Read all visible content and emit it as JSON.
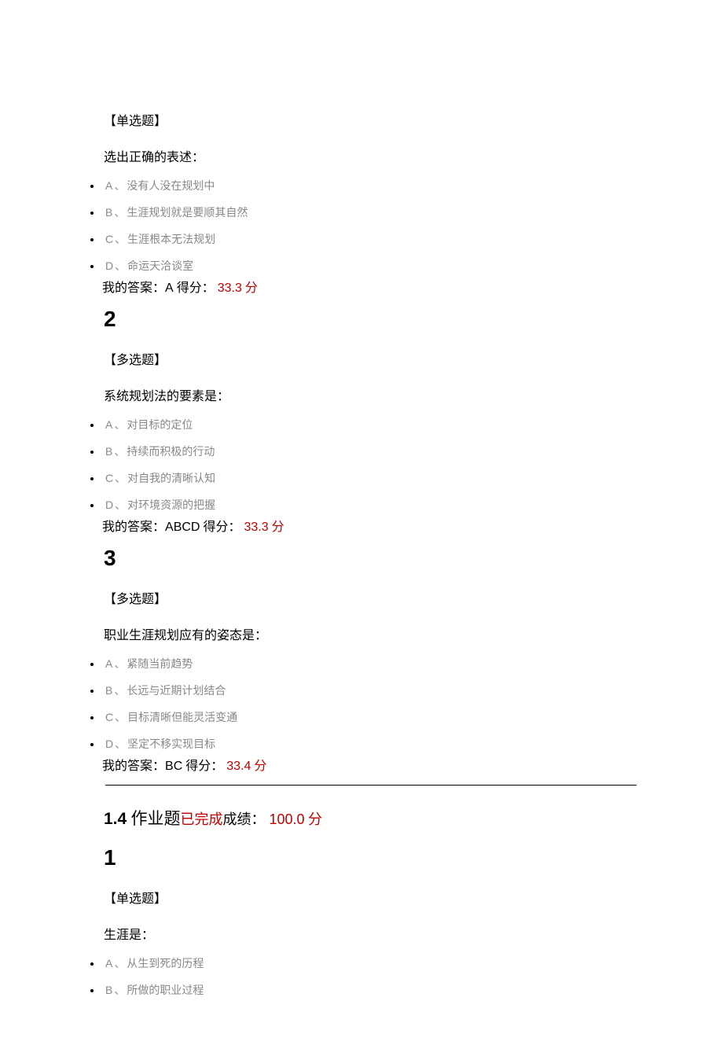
{
  "q1": {
    "type": "【单选题】",
    "prompt": "选出正确的表述：",
    "options": [
      {
        "letter": "A",
        "text": "没有人没在规划中"
      },
      {
        "letter": "B",
        "text": "生涯规划就是要顺其自然"
      },
      {
        "letter": "C",
        "text": "生涯根本无法规划"
      },
      {
        "letter": "D",
        "text": "命运天洽谈室"
      }
    ],
    "answer": "A",
    "score": "33.3"
  },
  "q2": {
    "num": "2",
    "type": "【多选题】",
    "prompt": "系统规划法的要素是：",
    "options": [
      {
        "letter": "A",
        "text": "对目标的定位"
      },
      {
        "letter": "B",
        "text": "持续而积极的行动"
      },
      {
        "letter": "C",
        "text": "对自我的清晰认知"
      },
      {
        "letter": "D",
        "text": "对环境资源的把握"
      }
    ],
    "answer": "ABCD",
    "score": "33.3"
  },
  "q3": {
    "num": "3",
    "type": "【多选题】",
    "prompt": "职业生涯规划应有的姿态是：",
    "options": [
      {
        "letter": "A",
        "text": "紧随当前趋势"
      },
      {
        "letter": "B",
        "text": "长远与近期计划结合"
      },
      {
        "letter": "C",
        "text": "目标清晰但能灵活变通"
      },
      {
        "letter": "D",
        "text": "坚定不移实现目标"
      }
    ],
    "answer": "BC",
    "score": "33.4"
  },
  "section": {
    "num": "1.4",
    "label": " 作业题",
    "done": "已完成",
    "grade_label": "成绩：",
    "grade": "100.0"
  },
  "q4": {
    "num": "1",
    "type": "【单选题】",
    "prompt": "生涯是：",
    "options": [
      {
        "letter": "A",
        "text": "从生到死的历程"
      },
      {
        "letter": "B",
        "text": "所做的职业过程"
      }
    ]
  },
  "labels": {
    "sep": "、",
    "my_answer": "我的答案：",
    "score_label": " 得分：",
    "unit": " 分"
  }
}
